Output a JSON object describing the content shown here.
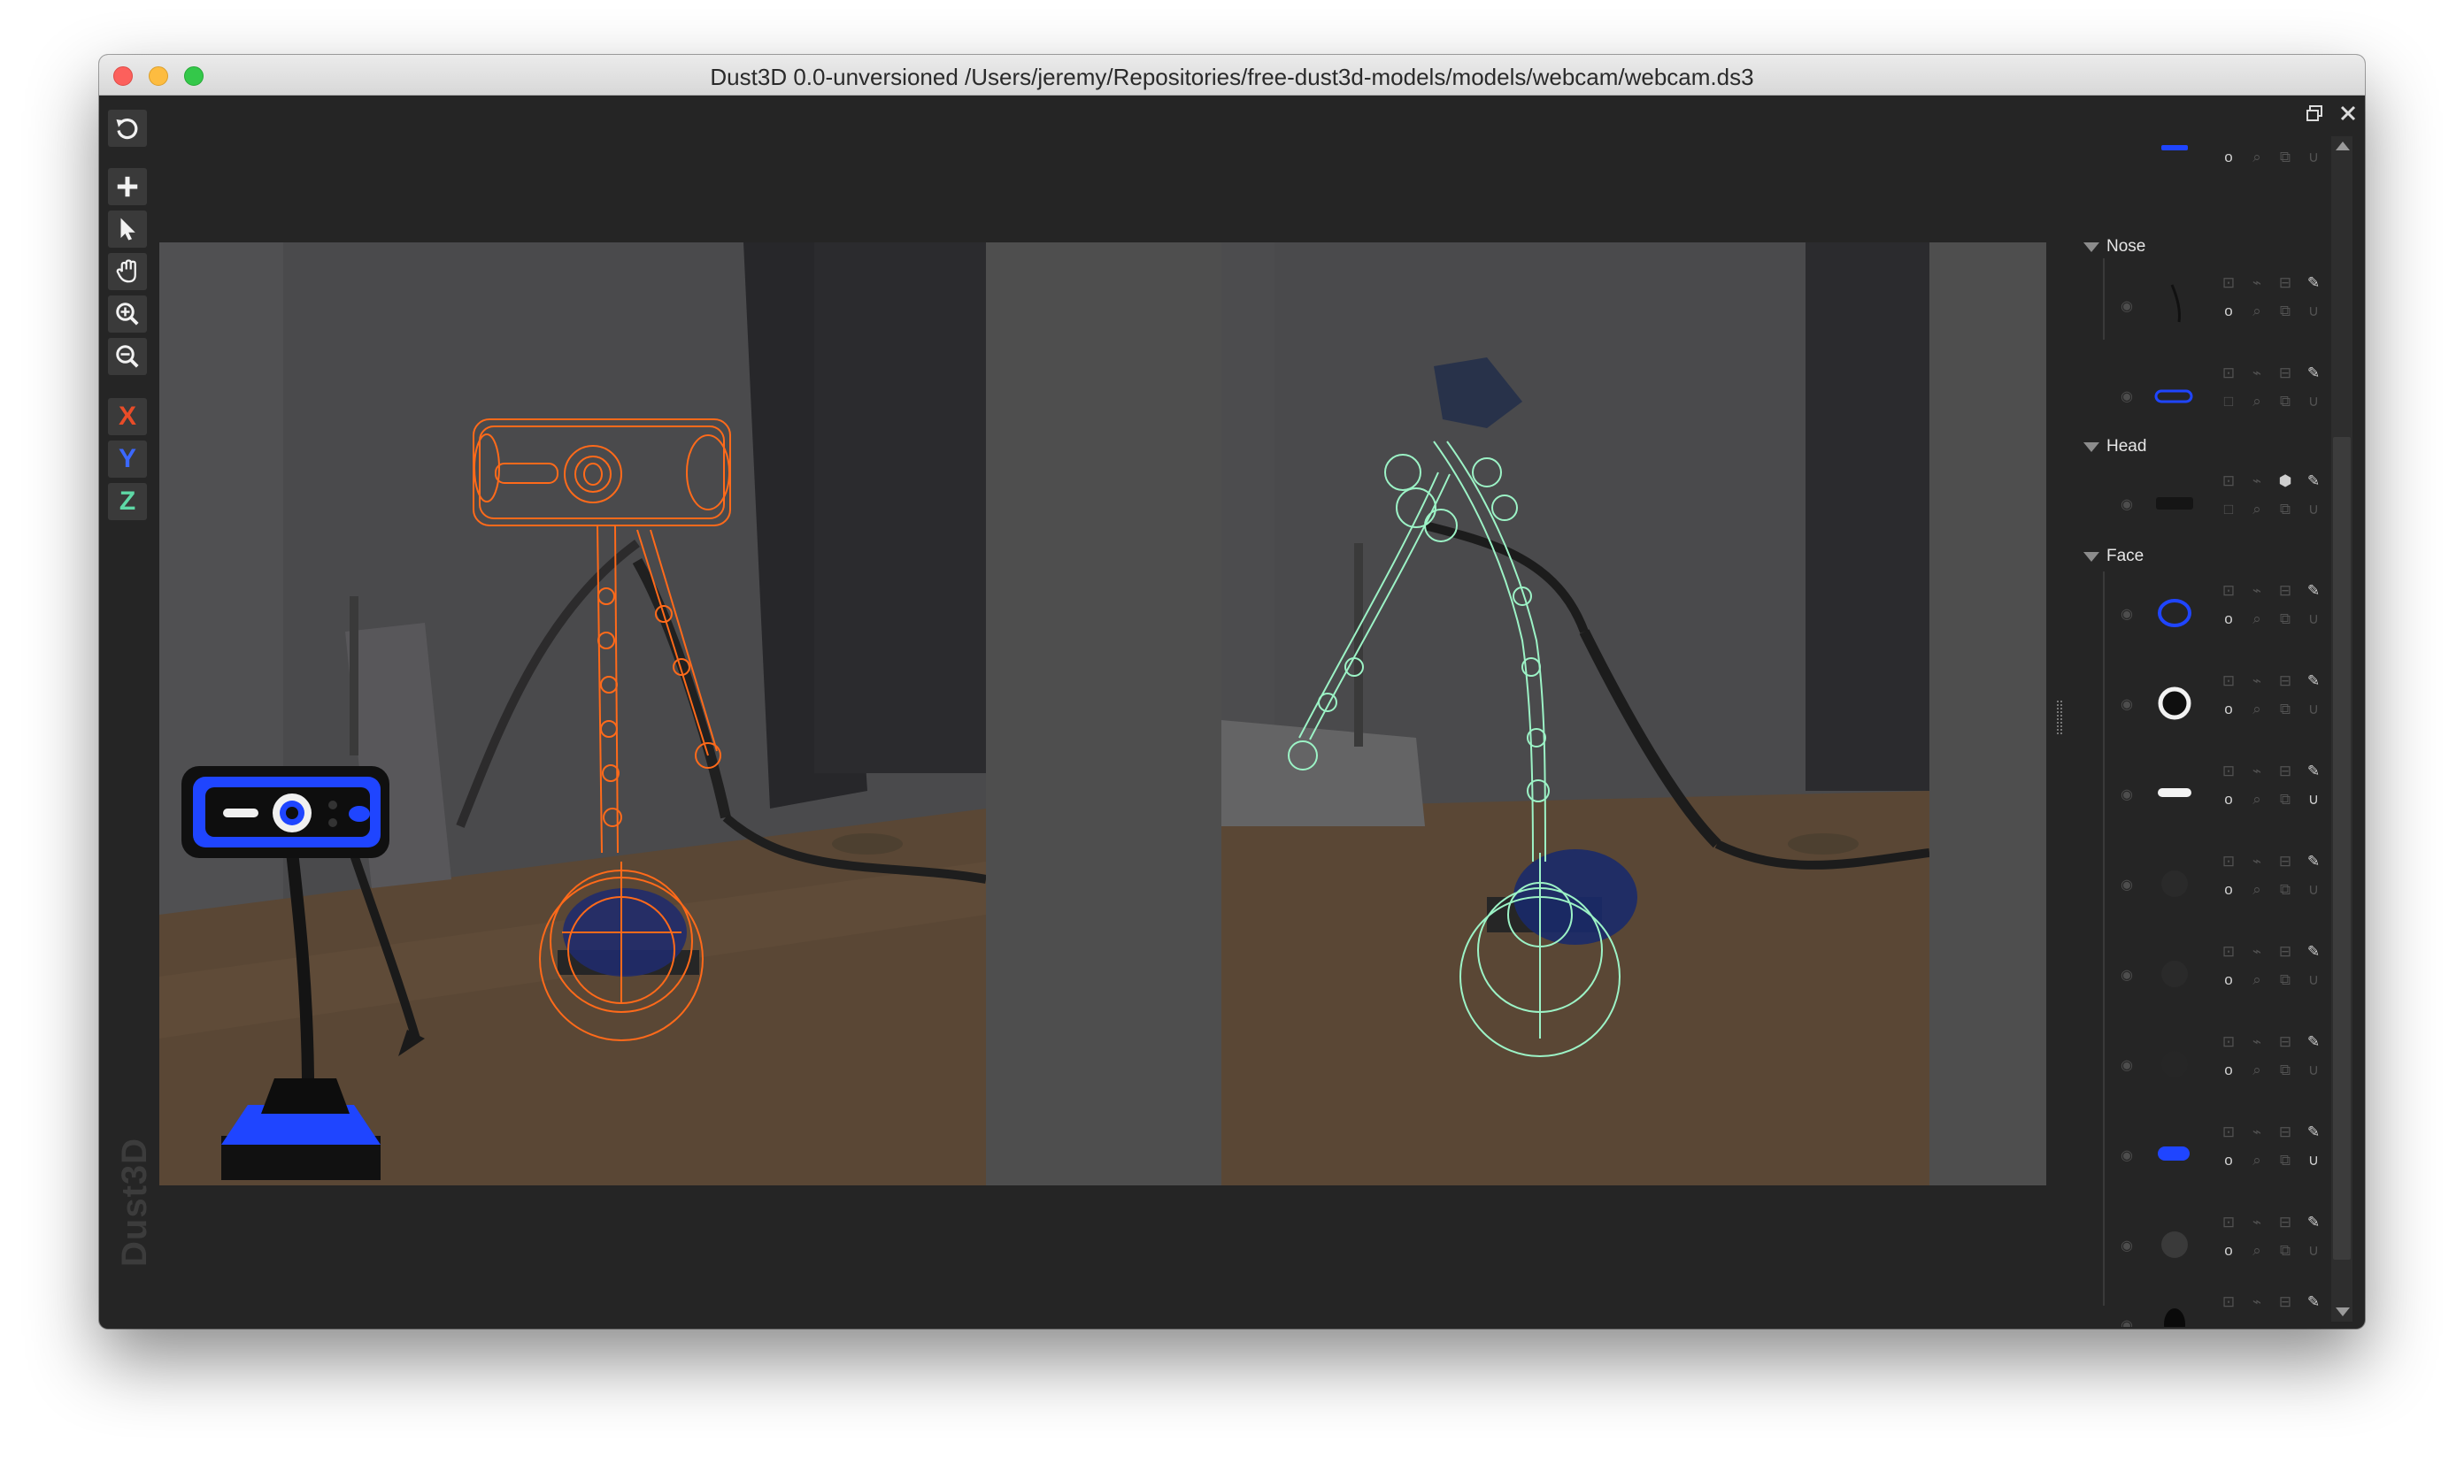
{
  "window": {
    "title": "Dust3D 0.0-unversioned /Users/jeremy/Repositories/free-dust3d-models/models/webcam/webcam.ds3",
    "brand": "Dust3D"
  },
  "toolbar": {
    "tools": [
      "undo-icon",
      "add-icon",
      "select-icon",
      "hand-icon",
      "zoom-in-icon",
      "zoom-out-icon"
    ],
    "axes": [
      {
        "label": "X",
        "color": "#e94c28"
      },
      {
        "label": "Y",
        "color": "#3b68ff"
      },
      {
        "label": "Z",
        "color": "#5ed8a6"
      }
    ]
  },
  "colors": {
    "front_wire": "#ff6a1a",
    "side_wire": "#9cf3c6",
    "model_blue": "#1f45ff",
    "background": "#252525"
  },
  "parts_panel": {
    "groups": [
      {
        "name": "Nose",
        "parts": [
          "nose-curve",
          "nose-slot"
        ]
      },
      {
        "name": "Head",
        "parts": [
          "head-body"
        ]
      },
      {
        "name": "Face",
        "parts": [
          "blue-ring",
          "white-ring",
          "white-bar",
          "dark-disc-1",
          "dark-disc-2",
          "dark-disc-3",
          "blue-button",
          "grey-disc",
          "black-oval"
        ]
      }
    ]
  }
}
